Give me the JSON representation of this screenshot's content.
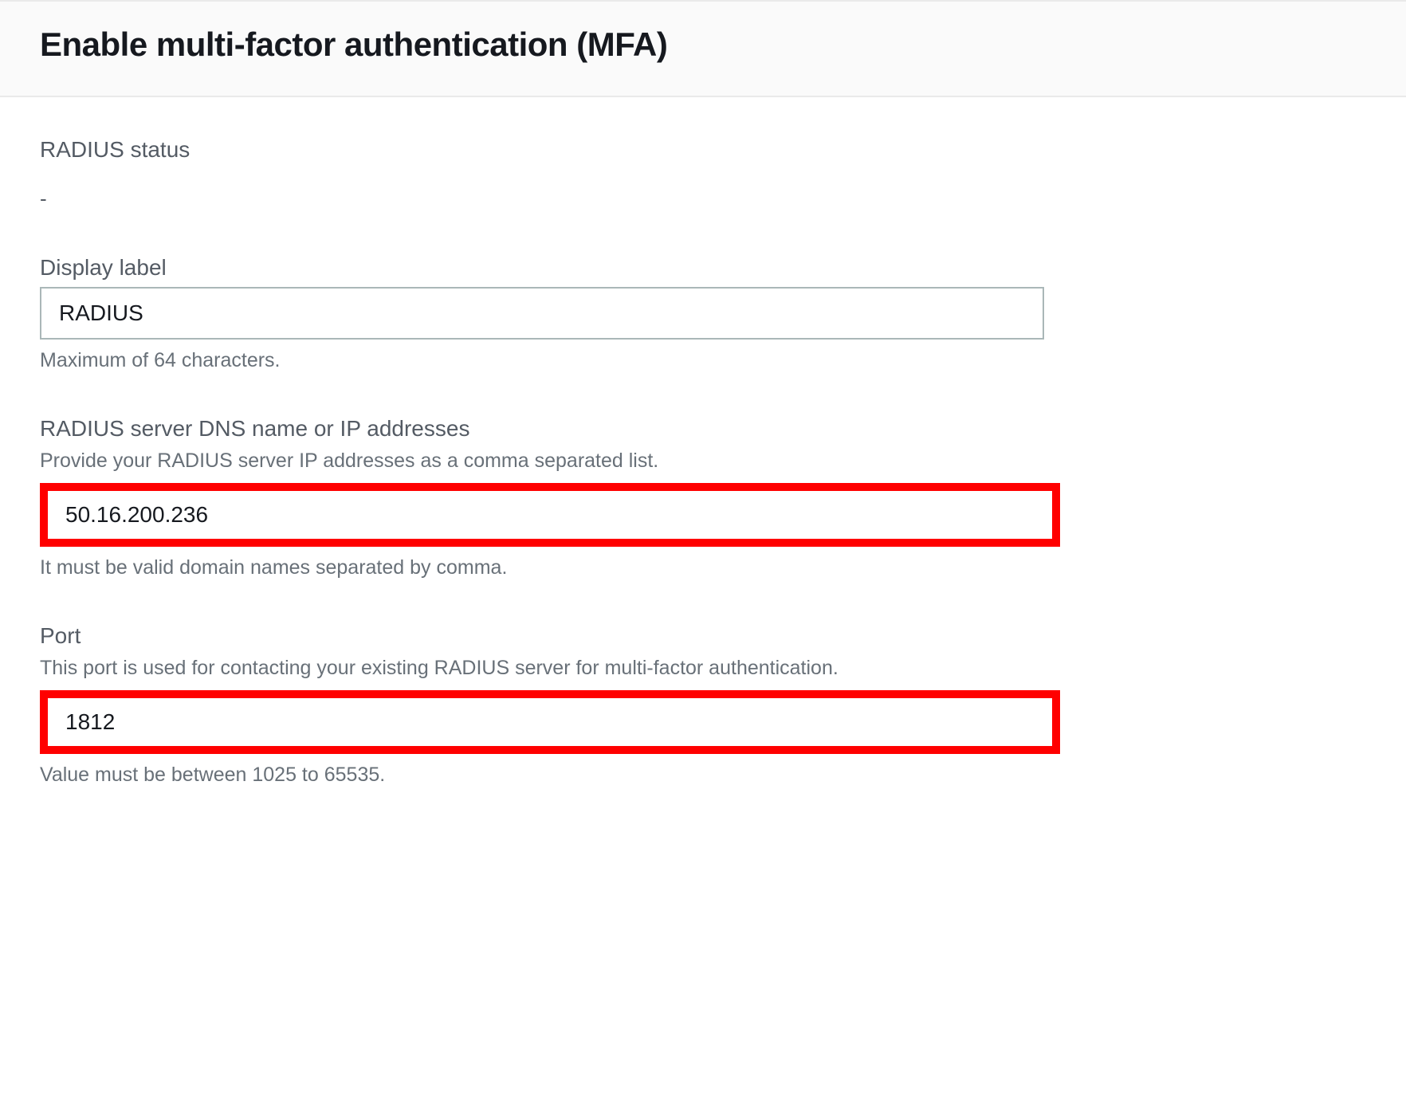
{
  "header": {
    "title": "Enable multi-factor authentication (MFA)"
  },
  "status": {
    "label": "RADIUS status",
    "value": "-"
  },
  "displayLabel": {
    "label": "Display label",
    "value": "RADIUS",
    "help": "Maximum of 64 characters."
  },
  "serverAddress": {
    "label": "RADIUS server DNS name or IP addresses",
    "subtext": "Provide your RADIUS server IP addresses as a comma separated list.",
    "value": "50.16.200.236",
    "help": "It must be valid domain names separated by comma."
  },
  "port": {
    "label": "Port",
    "subtext": "This port is used for contacting your existing RADIUS server for multi-factor authentication.",
    "value": "1812",
    "help": "Value must be between 1025 to 65535."
  }
}
